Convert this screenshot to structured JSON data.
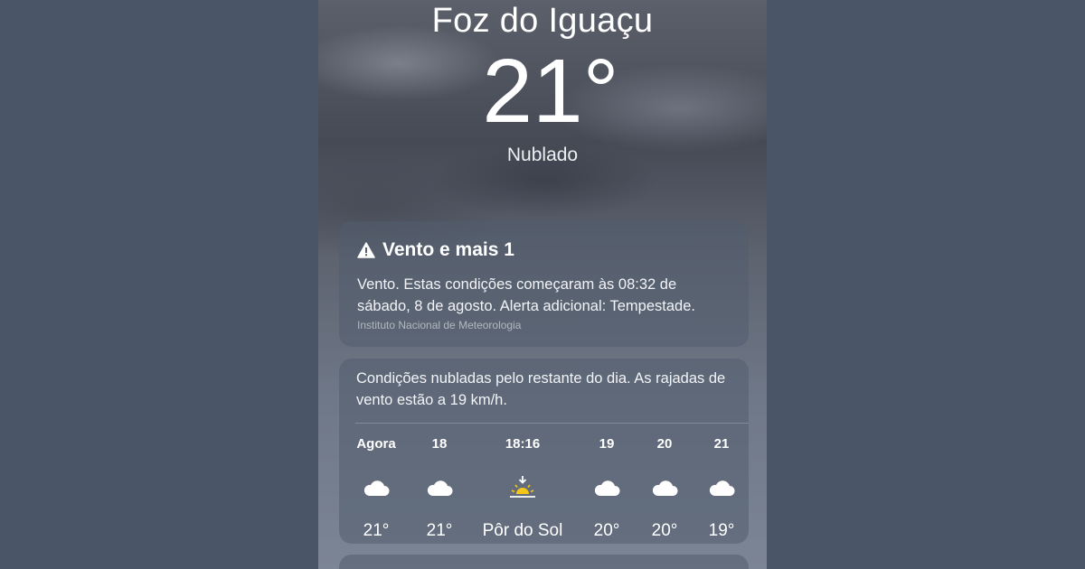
{
  "location": {
    "city": "Foz do Iguaçu",
    "temperature": "21°",
    "condition": "Nublado"
  },
  "alert": {
    "icon": "warning-triangle-icon",
    "title": "Vento e mais 1",
    "body": "Vento. Estas condições começaram às 08:32 de sábado, 8 de agosto. Alerta adicional: Tempestade.",
    "source": "Instituto Nacional de Meteorologia"
  },
  "hourly": {
    "summary": "Condições nubladas pelo restante do dia. As rajadas de vento estão a 19 km/h.",
    "items": [
      {
        "label": "Agora",
        "icon": "cloud-icon",
        "value": "21°"
      },
      {
        "label": "18",
        "icon": "cloud-icon",
        "value": "21°"
      },
      {
        "label": "18:16",
        "icon": "sunset-icon",
        "value": "Pôr do Sol"
      },
      {
        "label": "19",
        "icon": "cloud-icon",
        "value": "20°"
      },
      {
        "label": "20",
        "icon": "cloud-icon",
        "value": "20°"
      },
      {
        "label": "21",
        "icon": "cloud-icon",
        "value": "19°"
      }
    ]
  },
  "colors": {
    "background": "#4a5668",
    "text": "#ffffff",
    "sun": "#f5c518"
  }
}
